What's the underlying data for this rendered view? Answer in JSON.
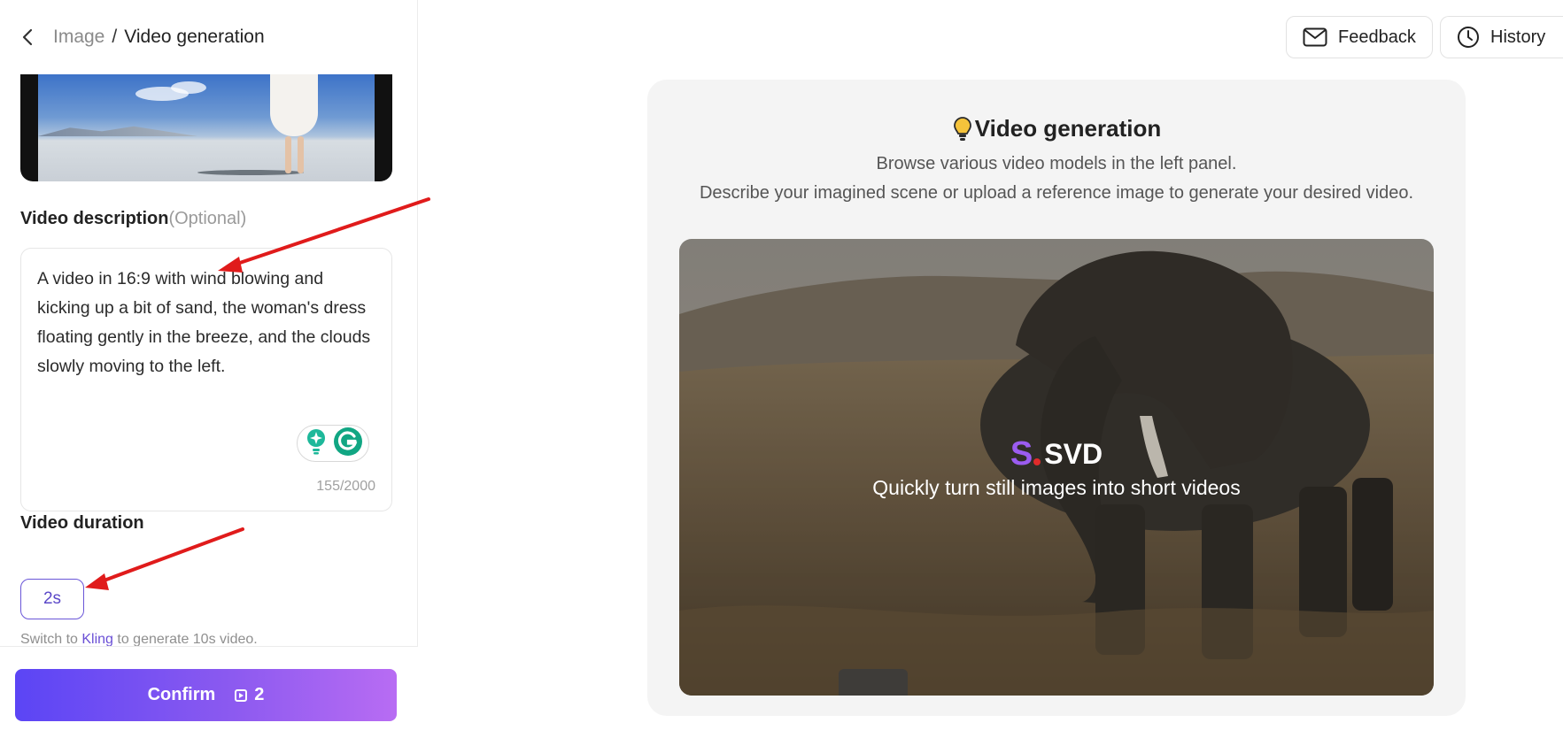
{
  "breadcrumb": {
    "parent": "Image",
    "separator": "/",
    "current": "Video generation"
  },
  "left": {
    "description": {
      "label": "Video description",
      "optional": "(Optional)",
      "text": "A video in 16:9 with wind blowing and kicking up a bit of sand, the woman's dress floating gently in the breeze, and the clouds slowly moving to the left.",
      "counter": "155/2000"
    },
    "duration": {
      "label": "Video duration",
      "selected": "2s",
      "hint_prefix": "Switch to ",
      "hint_link": "Kling",
      "hint_suffix": " to generate 10s video."
    },
    "confirm": {
      "label": "Confirm",
      "credits": "2"
    }
  },
  "header": {
    "feedback": "Feedback",
    "history": "History"
  },
  "main": {
    "title": "Video generation",
    "subtitle1": "Browse various video models in the left panel.",
    "subtitle2": "Describe your imagined scene or upload a reference image to generate your desired video.",
    "hero": {
      "logo_letter": "S",
      "logo_text": "SVD",
      "tagline": "Quickly turn still images into short videos"
    }
  },
  "colors": {
    "accent": "#6a56d8",
    "confirm_start": "#5b45f5",
    "confirm_end": "#b86cf3",
    "arrow": "#e01b1b"
  },
  "icons": [
    "chevron-left-icon",
    "mail-icon",
    "clock-icon",
    "lightbulb-icon",
    "grammarly-icon",
    "sparkle-assist-icon",
    "credit-icon"
  ]
}
